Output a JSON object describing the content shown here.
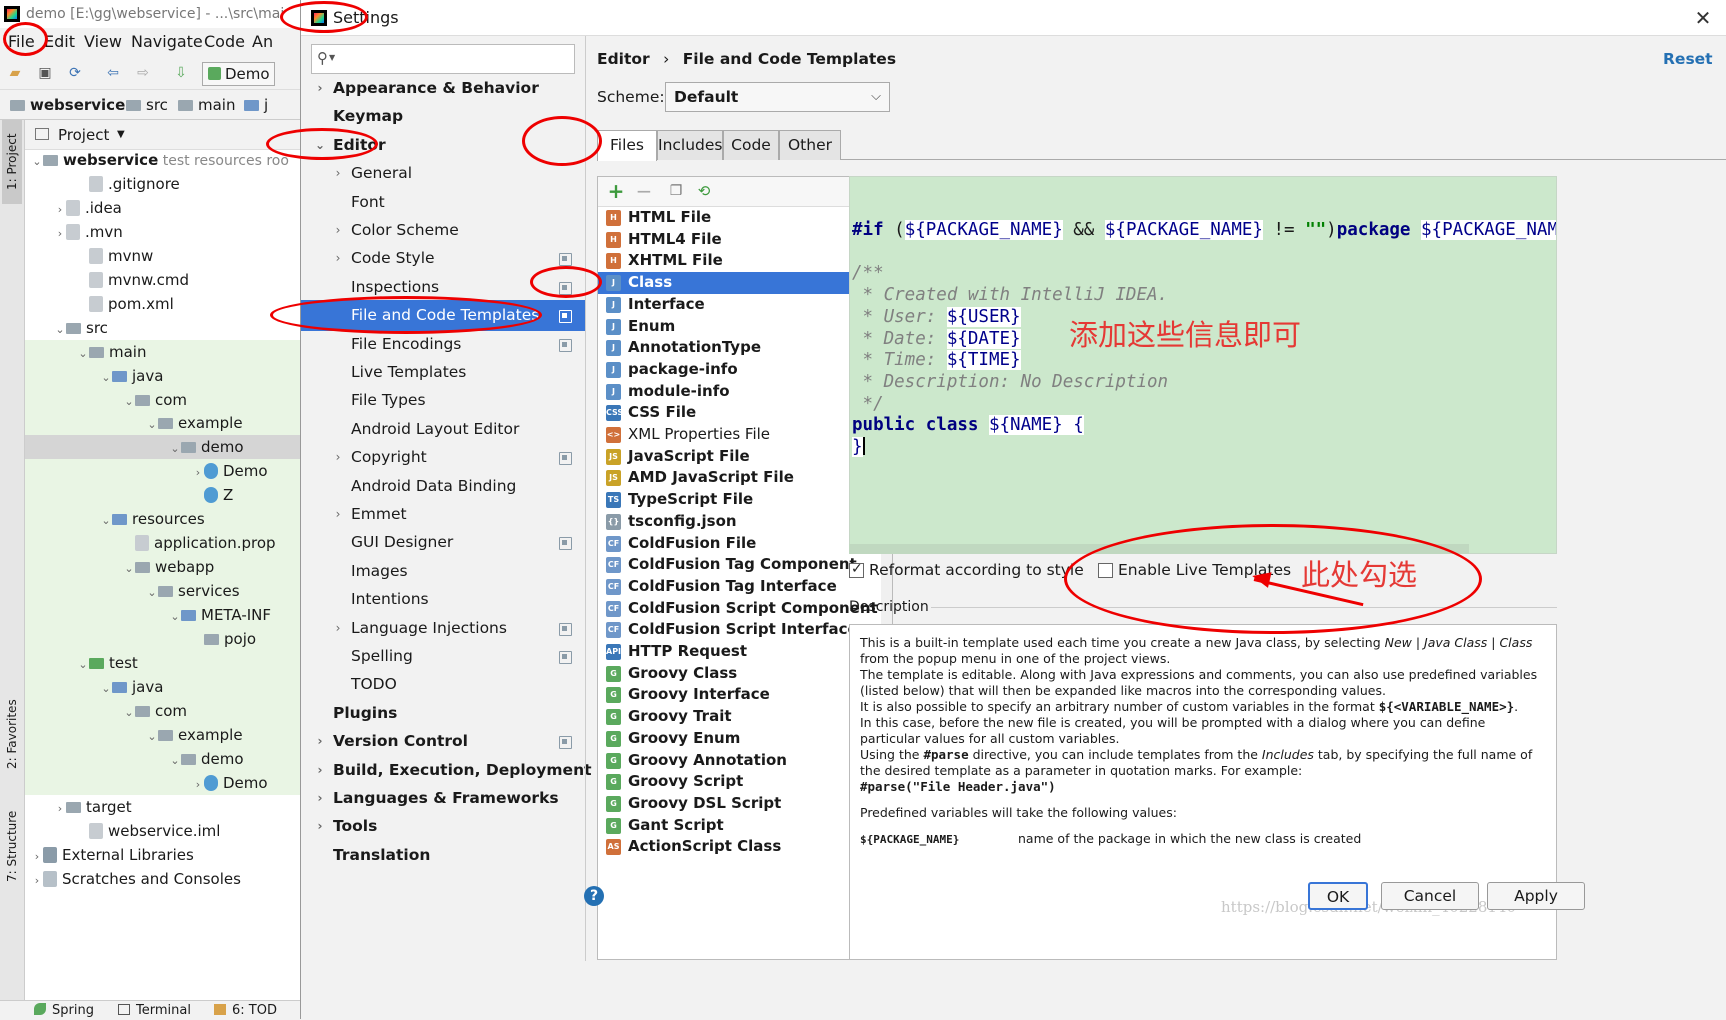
{
  "ide": {
    "title": "demo [E:\\gg\\webservice] - ...\\src\\mai",
    "menu": [
      "File",
      "Edit",
      "View",
      "Navigate",
      "Code",
      "An"
    ],
    "toolbar_run_config": "Demo",
    "breadcrumb": [
      "webservice",
      "src",
      "main",
      "j"
    ],
    "project_header": "Project",
    "side_tabs": [
      "1: Project",
      "2: Favorites",
      "7: Structure"
    ],
    "tree": [
      {
        "label": "webservice",
        "extra": "test resources roo",
        "depth": 0,
        "arrow": "down",
        "bold": true
      },
      {
        "label": ".gitignore",
        "depth": 2
      },
      {
        "label": ".idea",
        "depth": 1,
        "arrow": "right"
      },
      {
        "label": ".mvn",
        "depth": 1,
        "arrow": "right"
      },
      {
        "label": "mvnw",
        "depth": 2
      },
      {
        "label": "mvnw.cmd",
        "depth": 2
      },
      {
        "label": "pom.xml",
        "depth": 2
      },
      {
        "label": "src",
        "depth": 1,
        "arrow": "down"
      },
      {
        "label": "main",
        "depth": 2,
        "arrow": "down"
      },
      {
        "label": "java",
        "depth": 3,
        "arrow": "down"
      },
      {
        "label": "com",
        "depth": 4,
        "arrow": "down"
      },
      {
        "label": "example",
        "depth": 5,
        "arrow": "down"
      },
      {
        "label": "demo",
        "depth": 6,
        "arrow": "down"
      },
      {
        "label": "Demo",
        "depth": 7,
        "arrow": "right"
      },
      {
        "label": "Z",
        "depth": 7
      },
      {
        "label": "resources",
        "depth": 3,
        "arrow": "down"
      },
      {
        "label": "application.prop",
        "depth": 4
      },
      {
        "label": "webapp",
        "depth": 4,
        "arrow": "down"
      },
      {
        "label": "services",
        "depth": 5,
        "arrow": "down"
      },
      {
        "label": "META-INF",
        "depth": 6,
        "arrow": "down"
      },
      {
        "label": "pojo",
        "depth": 7
      },
      {
        "label": "test",
        "depth": 2,
        "arrow": "down"
      },
      {
        "label": "java",
        "depth": 3,
        "arrow": "down"
      },
      {
        "label": "com",
        "depth": 4,
        "arrow": "down"
      },
      {
        "label": "example",
        "depth": 5,
        "arrow": "down"
      },
      {
        "label": "demo",
        "depth": 6,
        "arrow": "down"
      },
      {
        "label": "Demo",
        "depth": 7,
        "arrow": "right"
      },
      {
        "label": "target",
        "depth": 1,
        "arrow": "right"
      },
      {
        "label": "webservice.iml",
        "depth": 2
      },
      {
        "label": "External Libraries",
        "depth": 0,
        "arrow": "right"
      },
      {
        "label": "Scratches and Consoles",
        "depth": 0,
        "arrow": "right"
      }
    ],
    "status": [
      "Spring",
      "Terminal",
      "6: TOD"
    ]
  },
  "dialog": {
    "title": "Settings",
    "close": "✕",
    "search_placeholder": "",
    "nav": [
      {
        "label": "Appearance & Behavior",
        "bold": true,
        "arrow": "right",
        "indent": 0
      },
      {
        "label": "Keymap",
        "bold": true,
        "indent": 0
      },
      {
        "label": "Editor",
        "bold": true,
        "arrow": "down",
        "indent": 0
      },
      {
        "label": "General",
        "arrow": "right",
        "indent": 1
      },
      {
        "label": "Font",
        "indent": 1
      },
      {
        "label": "Color Scheme",
        "arrow": "right",
        "indent": 1
      },
      {
        "label": "Code Style",
        "arrow": "right",
        "indent": 1,
        "proj": true
      },
      {
        "label": "Inspections",
        "indent": 1,
        "proj": true
      },
      {
        "label": "File and Code Templates",
        "indent": 1,
        "proj": true,
        "selected": true
      },
      {
        "label": "File Encodings",
        "indent": 1,
        "proj": true
      },
      {
        "label": "Live Templates",
        "indent": 1
      },
      {
        "label": "File Types",
        "indent": 1
      },
      {
        "label": "Android Layout Editor",
        "indent": 1
      },
      {
        "label": "Copyright",
        "arrow": "right",
        "indent": 1,
        "proj": true
      },
      {
        "label": "Android Data Binding",
        "indent": 1
      },
      {
        "label": "Emmet",
        "arrow": "right",
        "indent": 1
      },
      {
        "label": "GUI Designer",
        "indent": 1,
        "proj": true
      },
      {
        "label": "Images",
        "indent": 1
      },
      {
        "label": "Intentions",
        "indent": 1
      },
      {
        "label": "Language Injections",
        "arrow": "right",
        "indent": 1,
        "proj": true
      },
      {
        "label": "Spelling",
        "indent": 1,
        "proj": true
      },
      {
        "label": "TODO",
        "indent": 1
      },
      {
        "label": "Plugins",
        "bold": true,
        "indent": 0
      },
      {
        "label": "Version Control",
        "bold": true,
        "arrow": "right",
        "indent": 0,
        "proj": true
      },
      {
        "label": "Build, Execution, Deployment",
        "bold": true,
        "arrow": "right",
        "indent": 0
      },
      {
        "label": "Languages & Frameworks",
        "bold": true,
        "arrow": "right",
        "indent": 0
      },
      {
        "label": "Tools",
        "bold": true,
        "arrow": "right",
        "indent": 0
      },
      {
        "label": "Translation",
        "bold": true,
        "indent": 0
      }
    ],
    "breadcrumb": {
      "parent": "Editor",
      "sep": "›",
      "current": "File and Code Templates"
    },
    "reset": "Reset",
    "scheme": {
      "label": "Scheme:",
      "value": "Default"
    },
    "tabs": [
      "Files",
      "Includes",
      "Code",
      "Other"
    ],
    "templates": [
      {
        "label": "HTML File",
        "bold": true,
        "icon": "H",
        "color": "#d0703a"
      },
      {
        "label": "HTML4 File",
        "bold": true,
        "icon": "H",
        "color": "#d0703a"
      },
      {
        "label": "XHTML File",
        "bold": true,
        "icon": "H",
        "color": "#d0703a"
      },
      {
        "label": "Class",
        "bold": true,
        "icon": "J",
        "color": "#5b8fc7",
        "selected": true
      },
      {
        "label": "Interface",
        "bold": true,
        "icon": "J",
        "color": "#5b8fc7"
      },
      {
        "label": "Enum",
        "bold": true,
        "icon": "J",
        "color": "#5b8fc7"
      },
      {
        "label": "AnnotationType",
        "bold": true,
        "icon": "J",
        "color": "#5b8fc7"
      },
      {
        "label": "package-info",
        "bold": true,
        "icon": "J",
        "color": "#5b8fc7"
      },
      {
        "label": "module-info",
        "bold": true,
        "icon": "J",
        "color": "#5b8fc7"
      },
      {
        "label": "CSS File",
        "bold": true,
        "icon": "CSS",
        "color": "#3a77b8"
      },
      {
        "label": "XML Properties File",
        "bold": false,
        "icon": "<>",
        "color": "#d0703a"
      },
      {
        "label": "JavaScript File",
        "bold": true,
        "icon": "JS",
        "color": "#c9a227"
      },
      {
        "label": "AMD JavaScript File",
        "bold": true,
        "icon": "JS",
        "color": "#c9a227"
      },
      {
        "label": "TypeScript File",
        "bold": true,
        "icon": "TS",
        "color": "#3a77b8"
      },
      {
        "label": "tsconfig.json",
        "bold": true,
        "icon": "{}",
        "color": "#8a9ba8"
      },
      {
        "label": "ColdFusion File",
        "bold": true,
        "icon": "CF",
        "color": "#6f97c9"
      },
      {
        "label": "ColdFusion Tag Component",
        "bold": true,
        "icon": "CF",
        "color": "#6f97c9"
      },
      {
        "label": "ColdFusion Tag Interface",
        "bold": true,
        "icon": "CF",
        "color": "#6f97c9"
      },
      {
        "label": "ColdFusion Script Component",
        "bold": true,
        "icon": "CF",
        "color": "#6f97c9"
      },
      {
        "label": "ColdFusion Script Interface",
        "bold": true,
        "icon": "CF",
        "color": "#6f97c9"
      },
      {
        "label": "HTTP Request",
        "bold": true,
        "icon": "API",
        "color": "#3a77b8"
      },
      {
        "label": "Groovy Class",
        "bold": true,
        "icon": "G",
        "color": "#5aa95d"
      },
      {
        "label": "Groovy Interface",
        "bold": true,
        "icon": "G",
        "color": "#5aa95d"
      },
      {
        "label": "Groovy Trait",
        "bold": true,
        "icon": "G",
        "color": "#5aa95d"
      },
      {
        "label": "Groovy Enum",
        "bold": true,
        "icon": "G",
        "color": "#5aa95d"
      },
      {
        "label": "Groovy Annotation",
        "bold": true,
        "icon": "G",
        "color": "#5aa95d"
      },
      {
        "label": "Groovy Script",
        "bold": true,
        "icon": "G",
        "color": "#5aa95d"
      },
      {
        "label": "Groovy DSL Script",
        "bold": true,
        "icon": "G",
        "color": "#5aa95d"
      },
      {
        "label": "Gant Script",
        "bold": true,
        "icon": "G",
        "color": "#5aa95d"
      },
      {
        "label": "ActionScript Class",
        "bold": true,
        "icon": "AS",
        "color": "#d0703a"
      }
    ],
    "code": {
      "line1_a": "#if",
      "line1_b": " (",
      "line1_v1": "${PACKAGE_NAME}",
      "line1_c": " && ",
      "line1_v2": "${PACKAGE_NAME}",
      "line1_d": " != ",
      "line1_s": "\"\"",
      "line1_e": ")",
      "line1_f": "package ",
      "line1_v3": "${PACKAGE_NAME}",
      "line1_g": ";#",
      "c_open": "/**",
      "c_created": " * Created with IntelliJ IDEA.",
      "c_user_k": " * User: ",
      "c_user_v": "${USER}",
      "c_date_k": " * Date: ",
      "c_date_v": "${DATE}",
      "c_time_k": " * Time: ",
      "c_time_v": "${TIME}",
      "c_desc": " * Description: No Description",
      "c_close": " */",
      "cls_kw": "public class ",
      "cls_v": "${NAME}",
      "cls_b": " {",
      "end": "}"
    },
    "annotation_info": "添加这些信息即可",
    "annotation_check": "此处勾选",
    "reformat_label": "Reformat according to style",
    "live_label": "Enable Live Templates",
    "description_label": "Description",
    "description": {
      "p1_a": "This is a built-in template used each time you create a new Java class, by selecting ",
      "p1_i": "New | Java Class | Class",
      "p1_b": " from the popup menu in one of the project views.",
      "p2": "The template is editable. Along with Java expressions and comments, you can also use predefined variables (listed below) that will then be expanded like macros into the corresponding values.",
      "p3_a": "It is also possible to specify an arbitrary number of custom variables in the format ",
      "p3_c": "${<VARIABLE_NAME>}",
      "p3_b": ".",
      "p4": "In this case, before the new file is created, you will be prompted with a dialog where you can define particular values for all custom variables.",
      "p5_a": "Using the ",
      "p5_c": "#parse",
      "p5_b": " directive, you can include templates from the ",
      "p5_i": "Includes",
      "p5_d": " tab, by specifying the full name of the desired template as a parameter in quotation marks. For example:",
      "p6": "#parse(\"File Header.java\")",
      "p7": "Predefined variables will take the following values:",
      "var_name": "${PACKAGE_NAME}",
      "var_desc": "name of the package in which the new class is created"
    },
    "buttons": {
      "ok": "OK",
      "cancel": "Cancel",
      "apply": "Apply",
      "help": "?"
    },
    "watermark": "https://blog.csdn.net/weixin_40228140"
  },
  "colors": {
    "selection": "#3875d7",
    "editor_bg": "#cce8cc",
    "annotation": "#e53935",
    "link": "#2470b3"
  }
}
